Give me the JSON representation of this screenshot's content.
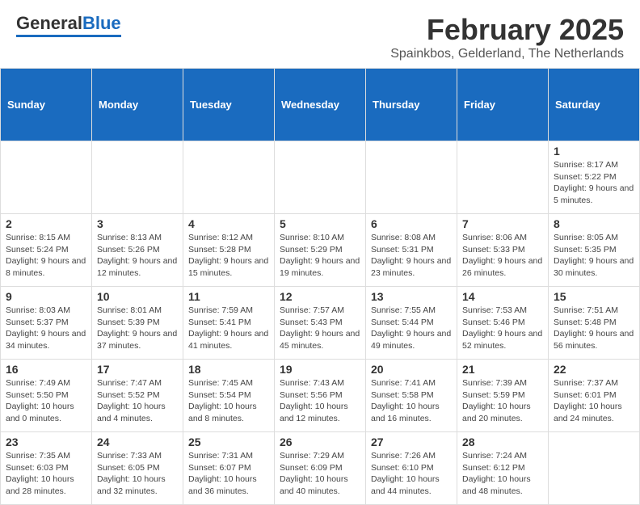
{
  "header": {
    "logo_general": "General",
    "logo_blue": "Blue",
    "month_title": "February 2025",
    "location": "Spainkbos, Gelderland, The Netherlands"
  },
  "days_of_week": [
    "Sunday",
    "Monday",
    "Tuesday",
    "Wednesday",
    "Thursday",
    "Friday",
    "Saturday"
  ],
  "weeks": [
    [
      {
        "day": "",
        "info": ""
      },
      {
        "day": "",
        "info": ""
      },
      {
        "day": "",
        "info": ""
      },
      {
        "day": "",
        "info": ""
      },
      {
        "day": "",
        "info": ""
      },
      {
        "day": "",
        "info": ""
      },
      {
        "day": "1",
        "info": "Sunrise: 8:17 AM\nSunset: 5:22 PM\nDaylight: 9 hours and 5 minutes."
      }
    ],
    [
      {
        "day": "2",
        "info": "Sunrise: 8:15 AM\nSunset: 5:24 PM\nDaylight: 9 hours and 8 minutes."
      },
      {
        "day": "3",
        "info": "Sunrise: 8:13 AM\nSunset: 5:26 PM\nDaylight: 9 hours and 12 minutes."
      },
      {
        "day": "4",
        "info": "Sunrise: 8:12 AM\nSunset: 5:28 PM\nDaylight: 9 hours and 15 minutes."
      },
      {
        "day": "5",
        "info": "Sunrise: 8:10 AM\nSunset: 5:29 PM\nDaylight: 9 hours and 19 minutes."
      },
      {
        "day": "6",
        "info": "Sunrise: 8:08 AM\nSunset: 5:31 PM\nDaylight: 9 hours and 23 minutes."
      },
      {
        "day": "7",
        "info": "Sunrise: 8:06 AM\nSunset: 5:33 PM\nDaylight: 9 hours and 26 minutes."
      },
      {
        "day": "8",
        "info": "Sunrise: 8:05 AM\nSunset: 5:35 PM\nDaylight: 9 hours and 30 minutes."
      }
    ],
    [
      {
        "day": "9",
        "info": "Sunrise: 8:03 AM\nSunset: 5:37 PM\nDaylight: 9 hours and 34 minutes."
      },
      {
        "day": "10",
        "info": "Sunrise: 8:01 AM\nSunset: 5:39 PM\nDaylight: 9 hours and 37 minutes."
      },
      {
        "day": "11",
        "info": "Sunrise: 7:59 AM\nSunset: 5:41 PM\nDaylight: 9 hours and 41 minutes."
      },
      {
        "day": "12",
        "info": "Sunrise: 7:57 AM\nSunset: 5:43 PM\nDaylight: 9 hours and 45 minutes."
      },
      {
        "day": "13",
        "info": "Sunrise: 7:55 AM\nSunset: 5:44 PM\nDaylight: 9 hours and 49 minutes."
      },
      {
        "day": "14",
        "info": "Sunrise: 7:53 AM\nSunset: 5:46 PM\nDaylight: 9 hours and 52 minutes."
      },
      {
        "day": "15",
        "info": "Sunrise: 7:51 AM\nSunset: 5:48 PM\nDaylight: 9 hours and 56 minutes."
      }
    ],
    [
      {
        "day": "16",
        "info": "Sunrise: 7:49 AM\nSunset: 5:50 PM\nDaylight: 10 hours and 0 minutes."
      },
      {
        "day": "17",
        "info": "Sunrise: 7:47 AM\nSunset: 5:52 PM\nDaylight: 10 hours and 4 minutes."
      },
      {
        "day": "18",
        "info": "Sunrise: 7:45 AM\nSunset: 5:54 PM\nDaylight: 10 hours and 8 minutes."
      },
      {
        "day": "19",
        "info": "Sunrise: 7:43 AM\nSunset: 5:56 PM\nDaylight: 10 hours and 12 minutes."
      },
      {
        "day": "20",
        "info": "Sunrise: 7:41 AM\nSunset: 5:58 PM\nDaylight: 10 hours and 16 minutes."
      },
      {
        "day": "21",
        "info": "Sunrise: 7:39 AM\nSunset: 5:59 PM\nDaylight: 10 hours and 20 minutes."
      },
      {
        "day": "22",
        "info": "Sunrise: 7:37 AM\nSunset: 6:01 PM\nDaylight: 10 hours and 24 minutes."
      }
    ],
    [
      {
        "day": "23",
        "info": "Sunrise: 7:35 AM\nSunset: 6:03 PM\nDaylight: 10 hours and 28 minutes."
      },
      {
        "day": "24",
        "info": "Sunrise: 7:33 AM\nSunset: 6:05 PM\nDaylight: 10 hours and 32 minutes."
      },
      {
        "day": "25",
        "info": "Sunrise: 7:31 AM\nSunset: 6:07 PM\nDaylight: 10 hours and 36 minutes."
      },
      {
        "day": "26",
        "info": "Sunrise: 7:29 AM\nSunset: 6:09 PM\nDaylight: 10 hours and 40 minutes."
      },
      {
        "day": "27",
        "info": "Sunrise: 7:26 AM\nSunset: 6:10 PM\nDaylight: 10 hours and 44 minutes."
      },
      {
        "day": "28",
        "info": "Sunrise: 7:24 AM\nSunset: 6:12 PM\nDaylight: 10 hours and 48 minutes."
      },
      {
        "day": "",
        "info": ""
      }
    ]
  ]
}
